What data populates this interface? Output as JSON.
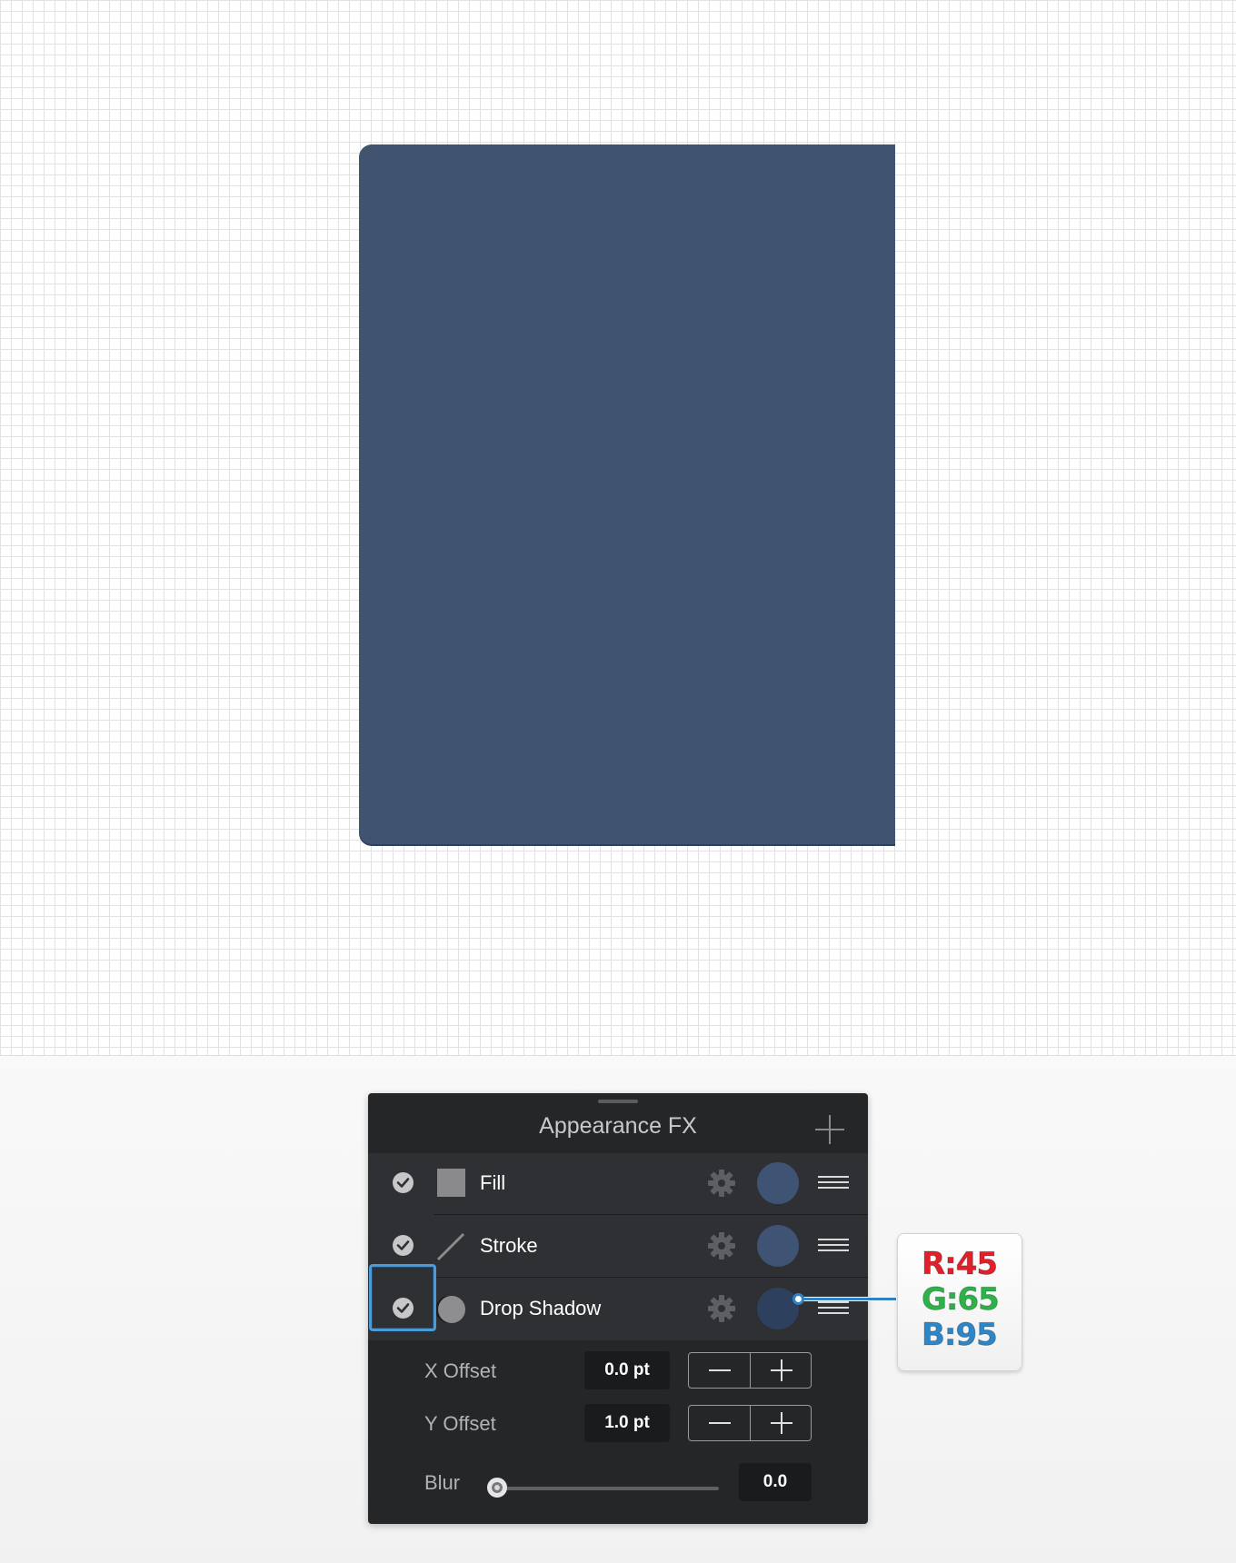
{
  "colors": {
    "shape_fill": "#41546F",
    "swatch_fill": "#3F5375",
    "swatch_stroke": "#3F5375",
    "swatch_shadow": "#2D415F",
    "highlight": "#4A9BD6",
    "rgb_r": "#E2202A",
    "rgb_g": "#2DB24A",
    "rgb_b": "#2C86C8"
  },
  "panel": {
    "title": "Appearance FX",
    "rows": [
      {
        "label": "Fill",
        "icon": "fill-square-icon",
        "enabled": true
      },
      {
        "label": "Stroke",
        "icon": "stroke-line-icon",
        "enabled": true
      },
      {
        "label": "Drop Shadow",
        "icon": "shadow-circle-icon",
        "enabled": true
      }
    ],
    "x_offset": {
      "label": "X Offset",
      "value": "0.0 pt"
    },
    "y_offset": {
      "label": "Y Offset",
      "value": "1.0 pt"
    },
    "blur": {
      "label": "Blur",
      "value": "0.0",
      "level": 0
    }
  },
  "callout": {
    "r": "R:45",
    "g": "G:65",
    "b": "B:95"
  }
}
